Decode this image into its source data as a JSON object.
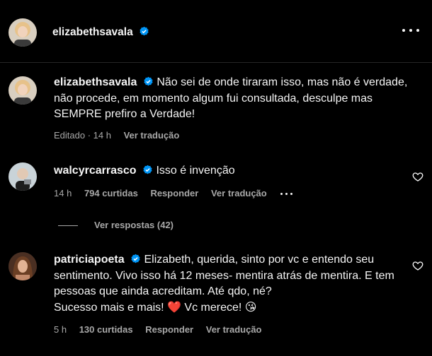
{
  "post": {
    "author": "elizabethsavala"
  },
  "comments": [
    {
      "user": "elizabethsavala",
      "text": "Não sei de onde tiraram isso, mas não é verdade, não procede, em momento algum fui consultada, desculpe mas SEMPRE prefiro a Verdade!",
      "meta_edited": "Editado · 14 h",
      "translate": "Ver tradução"
    },
    {
      "user": "walcyrcarrasco",
      "text": "Isso é invenção",
      "time": "14 h",
      "likes": "794 curtidas",
      "reply": "Responder",
      "translate": "Ver tradução",
      "view_replies": "Ver respostas (42)"
    },
    {
      "user": "patriciapoeta",
      "text_lines": [
        "Elizabeth, querida, sinto por vc e entendo seu sentimento. Vivo isso há 12 meses- mentira atrás de mentira. E tem pessoas que ainda acreditam. Até qdo, né?",
        "Sucesso mais e mais! ❤️  Vc merece! 😘"
      ],
      "time": "5 h",
      "likes": "130 curtidas",
      "reply": "Responder",
      "translate": "Ver tradução"
    }
  ],
  "colors": {
    "background": "#000000",
    "text": "#f5f5f5",
    "secondary": "#a8a8a8",
    "verified": "#0095f6"
  }
}
